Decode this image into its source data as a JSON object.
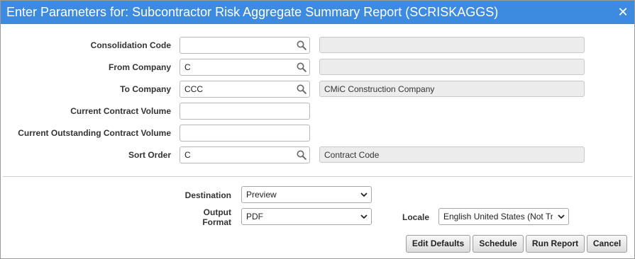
{
  "window": {
    "title": "Enter Parameters for: Subcontractor Risk Aggregate Summary Report (SCRISKAGGS)",
    "close_symbol": "✕"
  },
  "params": {
    "consolidation_code": {
      "label": "Consolidation Code",
      "value": "",
      "description": ""
    },
    "from_company": {
      "label": "From Company",
      "value": "C",
      "description": ""
    },
    "to_company": {
      "label": "To Company",
      "value": "CCC",
      "description": "CMiC Construction Company"
    },
    "current_contract_volume": {
      "label": "Current Contract Volume",
      "value": ""
    },
    "current_outstanding_contract_volume": {
      "label": "Current Outstanding Contract Volume",
      "value": ""
    },
    "sort_order": {
      "label": "Sort Order",
      "value": "C",
      "description": "Contract Code"
    }
  },
  "output": {
    "destination": {
      "label": "Destination",
      "value": "Preview"
    },
    "output_format": {
      "label_line1": "Output",
      "label_line2": "Format",
      "value": "PDF"
    },
    "locale": {
      "label": "Locale",
      "value": "English United States (Not Tr"
    }
  },
  "buttons": {
    "edit_defaults": "Edit Defaults",
    "schedule": "Schedule",
    "run_report": "Run Report",
    "cancel": "Cancel"
  },
  "icons": {
    "lookup": "search-icon",
    "dropdown": "chevron-down-icon",
    "close": "close-icon"
  },
  "colors": {
    "titlebar": "#3d8be0",
    "readonly_field": "#ececec"
  }
}
